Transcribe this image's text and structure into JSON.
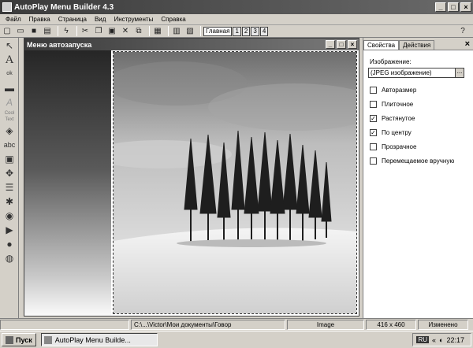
{
  "app": {
    "title": "AutoPlay Menu Builder 4.3"
  },
  "window_buttons": {
    "minimize": "_",
    "maximize": "□",
    "close": "×"
  },
  "menu": [
    "Файл",
    "Правка",
    "Страница",
    "Вид",
    "Инструменты",
    "Справка"
  ],
  "toolbar": {
    "page_tabs": [
      "Главная",
      "1",
      "2",
      "3",
      "4"
    ]
  },
  "document": {
    "title": "Меню автозапуска"
  },
  "properties_panel": {
    "tabs": [
      "Свойства",
      "Действия"
    ],
    "close": "×",
    "image_label": "Изображение:",
    "image_value": "(JPEG изображение)",
    "image_button": "...",
    "options": [
      {
        "label": "Авторазмер",
        "checked": false
      },
      {
        "label": "Плиточное",
        "checked": false
      },
      {
        "label": "Растянутое",
        "checked": true
      },
      {
        "label": "По центру",
        "checked": true
      },
      {
        "label": "Прозрачное",
        "checked": false
      },
      {
        "label": "Перемещаемое вручную",
        "checked": false
      }
    ]
  },
  "statusbar": {
    "path": "C:\\...\\Victor\\Мои документы\\Говор",
    "type": "Image",
    "size": "416 x 460",
    "state": "Изменено"
  },
  "taskbar": {
    "start": "Пуск",
    "task": "AutoPlay Menu Builde...",
    "lang": "RU",
    "time": "22:17"
  }
}
